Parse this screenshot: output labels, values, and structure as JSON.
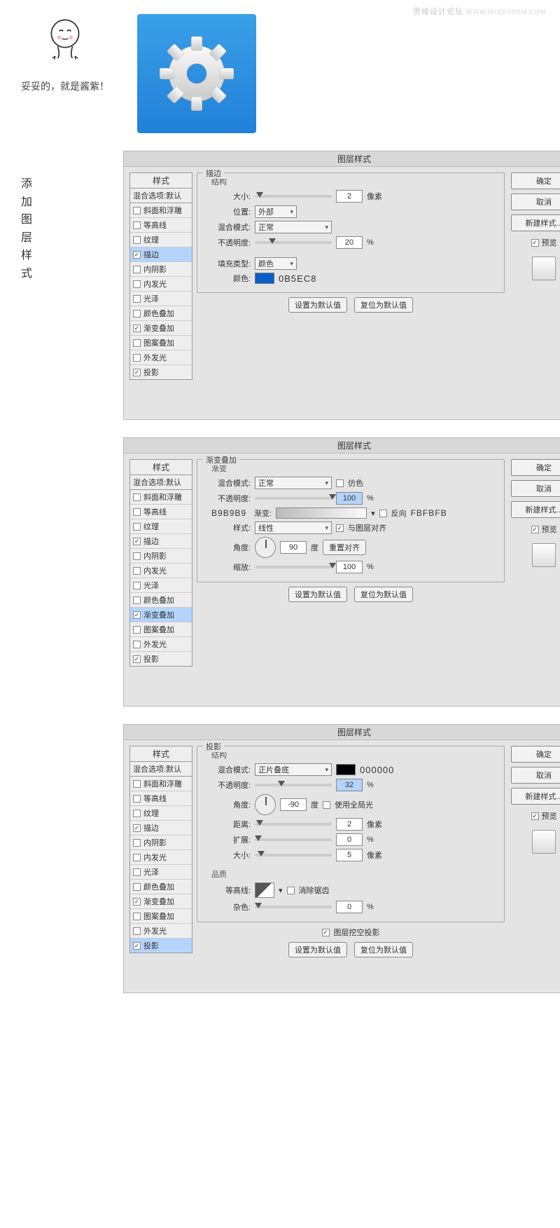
{
  "watermark": {
    "main": "思缘设计论坛",
    "sub": "WWW.MISSYUAN.COM"
  },
  "caption": "妥妥的，就是酱紫！",
  "article_label_l1": "添加图层",
  "article_label_l2": "样式",
  "dialog_title": "图层样式",
  "styles_header": "样式",
  "blend_options": "混合选项:默认",
  "style_items": [
    "斜面和浮雕",
    "等高线",
    "纹理",
    "描边",
    "内阴影",
    "内发光",
    "光泽",
    "颜色叠加",
    "渐变叠加",
    "图案叠加",
    "外发光",
    "投影"
  ],
  "right": {
    "ok": "确定",
    "cancel": "取消",
    "new_style": "新建样式...",
    "preview": "预览"
  },
  "common": {
    "set_default": "设置为默认值",
    "reset_default": "复位为默认值",
    "blend_mode": "混合模式:",
    "opacity": "不透明度:",
    "angle": "角度:",
    "degree": "度",
    "pct": "%",
    "px": "像素",
    "size": "大小:"
  },
  "panel1": {
    "title": "描边",
    "sub": "结构",
    "position": "位置:",
    "pos_val": "外部",
    "blend_val": "正常",
    "size_val": "2",
    "opacity_val": "20",
    "fill_type": "填充类型:",
    "fill_val": "颜色",
    "color_label": "颜色:",
    "color_hex": "0B5EC8"
  },
  "panel2": {
    "title": "渐变叠加",
    "sub": "渐变",
    "blend_val": "正常",
    "dither": "仿色",
    "opacity_val": "100",
    "grad_label": "渐变:",
    "reverse": "反向",
    "grad_hex_l": "B9B9B9",
    "grad_hex_r": "FBFBFB",
    "style": "样式:",
    "style_val": "线性",
    "align": "与图层对齐",
    "angle_val": "90",
    "reset_align": "重置对齐",
    "scale": "缩放:",
    "scale_val": "100"
  },
  "panel3": {
    "title": "投影",
    "sub": "结构",
    "blend_val": "正片叠底",
    "color_hex": "000000",
    "opacity_val": "32",
    "angle_val": "-90",
    "global": "使用全局光",
    "distance": "距离:",
    "distance_val": "2",
    "spread": "扩展:",
    "spread_val": "0",
    "size_val": "5",
    "quality": "品质",
    "contour": "等高线:",
    "anti": "消除锯齿",
    "noise": "杂色:",
    "noise_val": "0",
    "knockout": "图层挖空投影"
  }
}
